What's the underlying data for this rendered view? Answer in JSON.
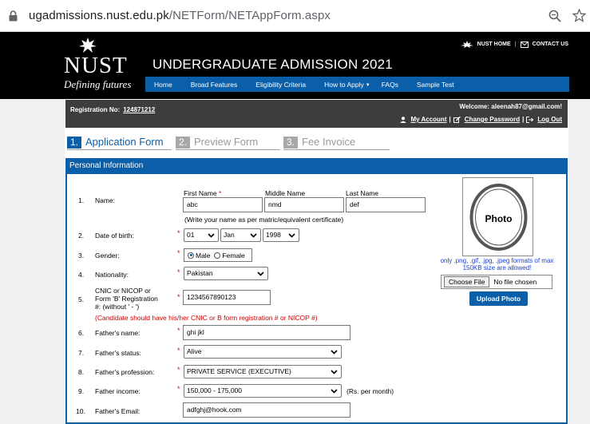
{
  "browser": {
    "url_host": "ugadmissions.nust.edu.pk",
    "url_path": "/NETForm/NETAppForm.aspx"
  },
  "header": {
    "logo_text": "NUST",
    "logo_tagline": "Defining futures",
    "title": "UNDERGRADUATE ADMISSION 2021",
    "top_links": [
      "NUST HOME",
      "CONTACT US"
    ],
    "nav": [
      "Home",
      "Broad Features",
      "Eligibility Criteria",
      "How to Apply",
      "FAQs",
      "Sample Test"
    ]
  },
  "account": {
    "reg_label": "Registration No:",
    "reg_number": "124871212",
    "welcome": "Welcome: aleenah87@gmail.com!",
    "links": [
      "My Account",
      "Change Password",
      "Log Out"
    ]
  },
  "steps": [
    {
      "num": "1.",
      "label": "Application Form",
      "active": true
    },
    {
      "num": "2.",
      "label": "Preview Form",
      "active": false
    },
    {
      "num": "3.",
      "label": "Fee Invoice",
      "active": false
    }
  ],
  "section_title": "Personal Information",
  "form": {
    "name": {
      "num": "1.",
      "label": "Name:",
      "first_label": "First Name",
      "first_value": "abc",
      "middle_label": "Middle Name",
      "middle_value": "nmd",
      "last_label": "Last Name",
      "last_value": "def",
      "hint": "(Write your name as per matric/equivalent certificate)"
    },
    "dob": {
      "num": "2.",
      "label": "Date of birth:",
      "day": "01",
      "month": "Jan",
      "year": "1998"
    },
    "gender": {
      "num": "3.",
      "label": "Gender:",
      "options": [
        "Male",
        "Female"
      ],
      "selected": "Male"
    },
    "nationality": {
      "num": "4.",
      "label": "Nationality:",
      "value": "Pakistan"
    },
    "cnic": {
      "num": "5.",
      "label_lines": [
        "CNIC or NICOP or",
        "Form 'B' Registration",
        "#: (without ' - ')"
      ],
      "value": "1234567890123",
      "note": "(Candidate should have his/her CNIC or B form registration # or NICOP #)"
    },
    "father_name": {
      "num": "6.",
      "label": "Father's name:",
      "value": "ghi jkl"
    },
    "father_status": {
      "num": "7.",
      "label": "Father's status:",
      "value": "Alive"
    },
    "father_profession": {
      "num": "8.",
      "label": "Father's profession:",
      "value": "PRIVATE SERVICE (EXECUTIVE)"
    },
    "father_income": {
      "num": "9.",
      "label": "Father income:",
      "value": "150,000 - 175,000",
      "suffix": "(Rs. per month)"
    },
    "father_email": {
      "num": "10.",
      "label": "Father's Email:",
      "value": "adfghj@hook.com"
    }
  },
  "photo": {
    "placeholder": "Photo",
    "note": "only .png, .gif, .jpg, .jpeg formats of max 150KB size are allowed!",
    "choose_label": "Choose File",
    "file_status": "No file chosen",
    "upload_label": "Upload Photo"
  },
  "required_mark": "*",
  "colors": {
    "brand_blue": "#0b5ea8",
    "required_red": "#e00000"
  }
}
